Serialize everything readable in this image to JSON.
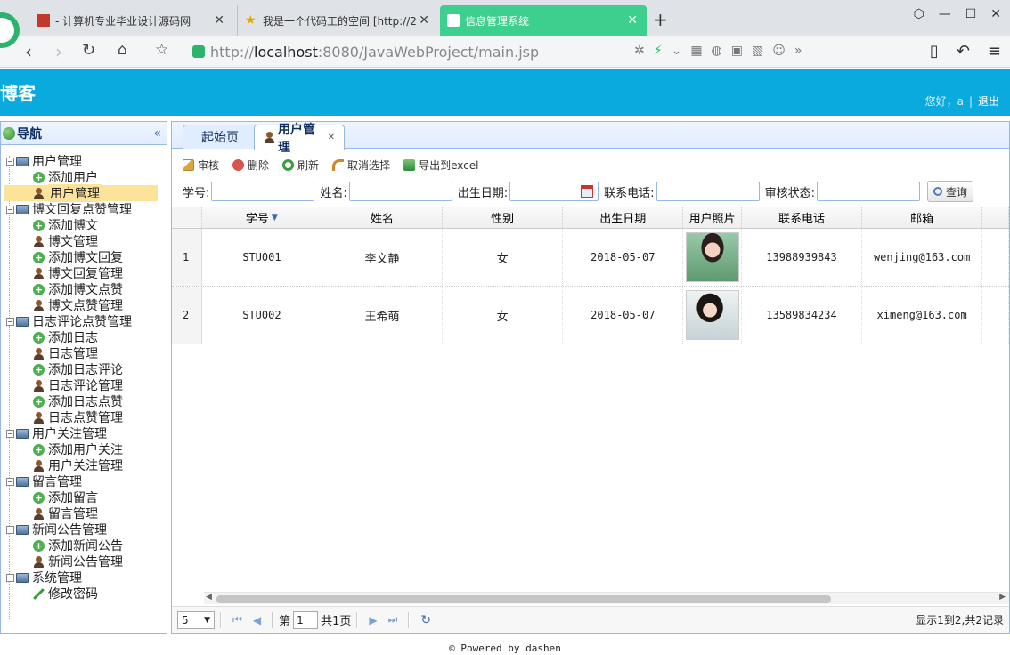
{
  "browser": {
    "tabs": [
      {
        "title": "- 计算机专业毕业设计源码网"
      },
      {
        "title": "我是一个代码工的空间 [http://2"
      },
      {
        "title": "信息管理系统"
      }
    ],
    "address": {
      "scheme": "http://",
      "host": "localhost",
      "path": ":8080/JavaWebProject/main.jsp"
    },
    "accent_color": "#3ccf8e"
  },
  "app": {
    "title": "博客",
    "greeting": "您好，a",
    "logout": "退出",
    "header_color": "#0aaadf"
  },
  "sidebar": {
    "title": "导航",
    "collapse_glyph": "«",
    "tree": [
      {
        "label": "用户管理",
        "children": [
          {
            "label": "添加用户",
            "icon": "add-icon"
          },
          {
            "label": "用户管理",
            "icon": "user-icon",
            "selected": true
          }
        ]
      },
      {
        "label": "博文回复点赞管理",
        "children": [
          {
            "label": "添加博文",
            "icon": "add-icon"
          },
          {
            "label": "博文管理",
            "icon": "user-icon"
          },
          {
            "label": "添加博文回复",
            "icon": "add-icon"
          },
          {
            "label": "博文回复管理",
            "icon": "user-icon"
          },
          {
            "label": "添加博文点赞",
            "icon": "add-icon"
          },
          {
            "label": "博文点赞管理",
            "icon": "user-icon"
          }
        ]
      },
      {
        "label": "日志评论点赞管理",
        "children": [
          {
            "label": "添加日志",
            "icon": "add-icon"
          },
          {
            "label": "日志管理",
            "icon": "user-icon"
          },
          {
            "label": "添加日志评论",
            "icon": "add-icon"
          },
          {
            "label": "日志评论管理",
            "icon": "user-icon"
          },
          {
            "label": "添加日志点赞",
            "icon": "add-icon"
          },
          {
            "label": "日志点赞管理",
            "icon": "user-icon"
          }
        ]
      },
      {
        "label": "用户关注管理",
        "children": [
          {
            "label": "添加用户关注",
            "icon": "add-icon"
          },
          {
            "label": "用户关注管理",
            "icon": "user-icon"
          }
        ]
      },
      {
        "label": "留言管理",
        "children": [
          {
            "label": "添加留言",
            "icon": "add-icon"
          },
          {
            "label": "留言管理",
            "icon": "user-icon"
          }
        ]
      },
      {
        "label": "新闻公告管理",
        "children": [
          {
            "label": "添加新闻公告",
            "icon": "add-icon"
          },
          {
            "label": "新闻公告管理",
            "icon": "user-icon"
          }
        ]
      },
      {
        "label": "系统管理",
        "children": [
          {
            "label": "修改密码",
            "icon": "pencil-icon"
          }
        ]
      }
    ]
  },
  "main": {
    "tabs": [
      {
        "label": "起始页"
      },
      {
        "label": "用户管理",
        "active": true
      }
    ],
    "toolbar": {
      "audit": "审核",
      "delete": "删除",
      "refresh": "刷新",
      "deselect": "取消选择",
      "export": "导出到excel"
    },
    "search": {
      "id_label": "学号:",
      "name_label": "姓名:",
      "dob_label": "出生日期:",
      "phone_label": "联系电话:",
      "status_label": "审核状态:",
      "query": "查询"
    },
    "grid": {
      "columns": [
        "学号",
        "姓名",
        "性别",
        "出生日期",
        "用户照片",
        "联系电话",
        "邮箱"
      ],
      "rows": [
        {
          "rownum": "1",
          "id": "STU001",
          "name": "李文静",
          "gender": "女",
          "dob": "2018-05-07",
          "phone": "13988939843",
          "email": "wenjing@163.com"
        },
        {
          "rownum": "2",
          "id": "STU002",
          "name": "王希萌",
          "gender": "女",
          "dob": "2018-05-07",
          "phone": "13589834234",
          "email": "ximeng@163.com"
        }
      ]
    },
    "pager": {
      "page_size": "5",
      "page_prefix": "第",
      "page_value": "1",
      "page_total": "共1页",
      "info": "显示1到2,共2记录"
    }
  },
  "footer": "© Powered by dashen"
}
